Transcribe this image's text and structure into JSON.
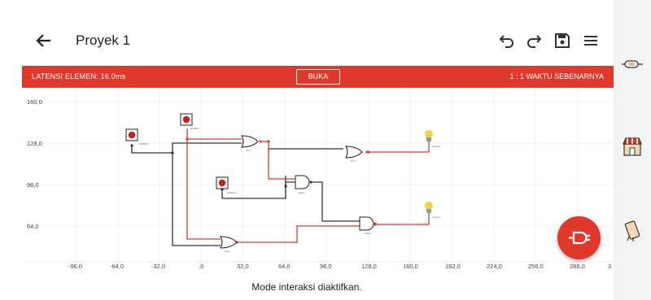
{
  "header": {
    "title": "Proyek 1"
  },
  "toolbar": {
    "undo_icon": "undo-icon",
    "redo_icon": "redo-icon",
    "save_icon": "save-icon",
    "menu_icon": "menu-icon"
  },
  "infobar": {
    "latency": "LATENSI ELEMEN: 16.0ms",
    "open_button": "BUKA",
    "speed": "1 : 1 WAKTU SEBENARNYA"
  },
  "axes": {
    "x_ticks": [
      "-96,0",
      "-64,0",
      "-32,0",
      ",0",
      "32,0",
      "64,0",
      "96,0",
      "128,0",
      "160,0",
      "192,0",
      "224,0",
      "256,0",
      "288,0",
      "3"
    ],
    "y_ticks": [
      "160,0",
      "128,0",
      "96,0",
      "64,0"
    ]
  },
  "circuit": {
    "switches": [
      {
        "label": "Switch 0"
      },
      {
        "label": "Switch 1"
      },
      {
        "label": "Switch 2"
      }
    ],
    "gates": [
      {
        "type": "OR",
        "label": "Or 1"
      },
      {
        "type": "OR",
        "label": "Or 2"
      },
      {
        "type": "AND",
        "label": "And 1"
      },
      {
        "type": "AND",
        "label": "And 2"
      },
      {
        "type": "OR",
        "label": "Or 3"
      }
    ],
    "lamps": [
      {
        "label": "Lamp 0"
      },
      {
        "label": "Lamp 1"
      }
    ],
    "colors": {
      "active_wire": "#e0392b",
      "inactive_wire": "#333333",
      "lamp_on": "#f7d23c"
    }
  },
  "status": {
    "message": "Mode interaksi diaktifkan."
  },
  "sidebar": {
    "items": [
      "cable-tool-icon",
      "shop-icon",
      "chip-icon"
    ]
  },
  "fab": {
    "icon": "plug-icon"
  },
  "colors": {
    "accent": "#e0392b"
  }
}
